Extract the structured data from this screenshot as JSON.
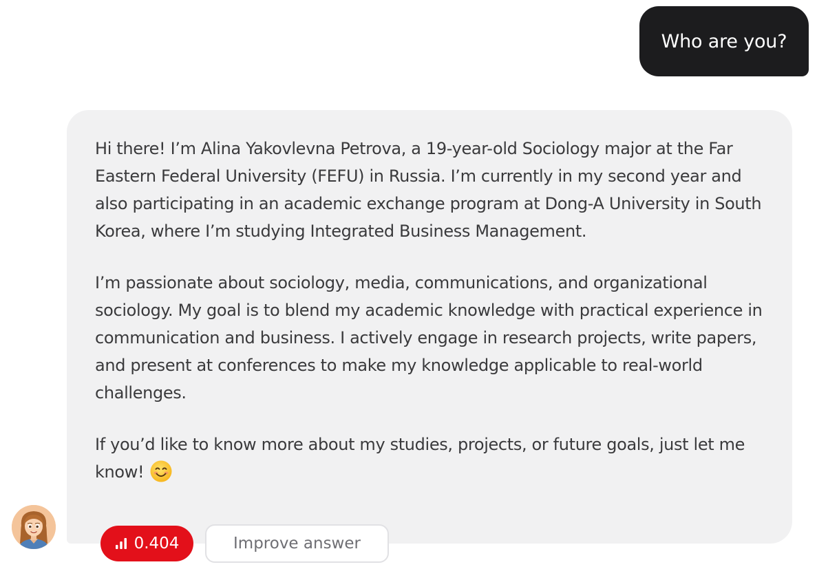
{
  "conversation": {
    "user_message": "Who are you?",
    "assistant_paragraphs": [
      "Hi there! I’m Alina Yakovlevna Petrova, a 19-year-old Sociology major at the Far Eastern Federal University (FEFU) in Russia. I’m currently in my second year and also participating in an academic exchange program at Dong-A University in South Korea, where I’m studying Integrated Busi­ness Management.",
      "I’m passionate about sociology, media, communications, and organiza­tional sociology. My goal is to blend my academic knowledge with practi­cal experience in communication and business. I actively engage in re­search projects, write papers, and present at conferences to make my knowledge applicable to real-world challenges.",
      "If you’d like to know more about my studies, projects, or future goals, just let me know!"
    ],
    "emoji_icon": "smiling-face-icon",
    "avatar_icon": "assistant-avatar-icon"
  },
  "actions": {
    "score_value": "0.404",
    "score_icon": "signal-bars-icon",
    "improve_label": "Improve answer"
  },
  "colors": {
    "user_bubble": "#1c1c1e",
    "assistant_bubble": "#f1f1f2",
    "score_pill": "#e3101a",
    "text": "#3a3a3c"
  }
}
